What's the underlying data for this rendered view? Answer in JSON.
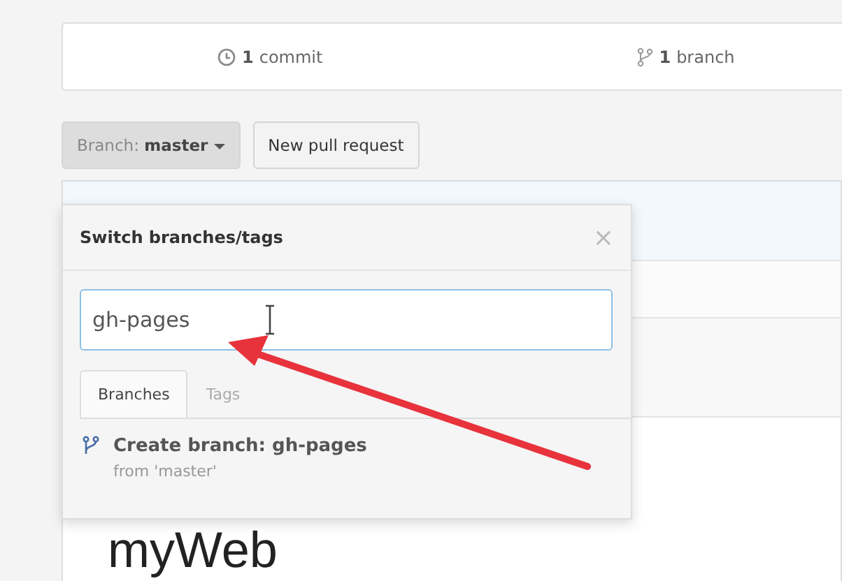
{
  "summary": [
    {
      "kind": "commit",
      "count": "1",
      "label": "commit"
    },
    {
      "kind": "branch",
      "count": "1",
      "label": "branch"
    }
  ],
  "branch_button": {
    "prefix": "Branch:",
    "name": "master"
  },
  "pull_request_button": "New pull request",
  "dropdown": {
    "title": "Switch branches/tags",
    "close": "×",
    "filter": {
      "value": "gh-pages"
    },
    "tabs": [
      {
        "label": "Branches",
        "selected": true
      },
      {
        "label": "Tags",
        "selected": false
      }
    ],
    "create_item": {
      "title": "Create branch: gh-pages",
      "subtitle": "from 'master'"
    }
  },
  "repo_title": "myWeb"
}
